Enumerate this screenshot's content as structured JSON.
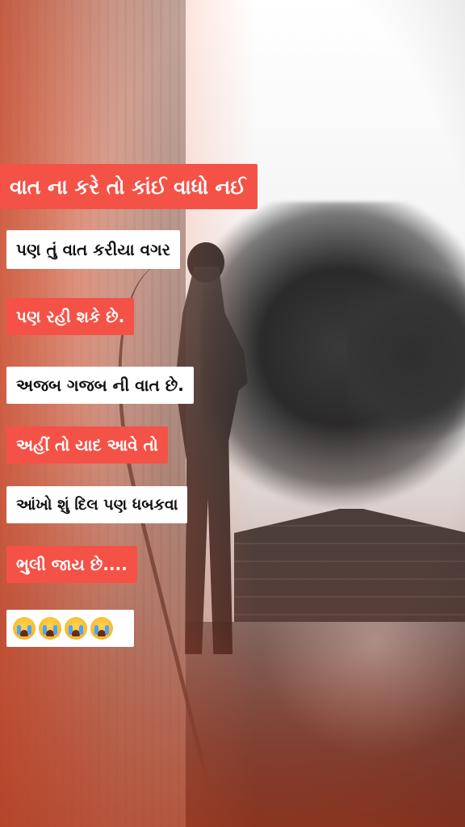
{
  "lines": [
    {
      "text": "વાત ના કરે તો કાંઈ વાધો નઈ",
      "style": "red"
    },
    {
      "text": "પણ તું વાત કરીયા વગર",
      "style": "white"
    },
    {
      "text": "પણ રહી શકે છે.",
      "style": "red"
    },
    {
      "text": "અજબ ગજબ ની વાત છે.",
      "style": "white"
    },
    {
      "text": "અહીં તો યાદ આવે તો",
      "style": "red"
    },
    {
      "text": "આંખો શું દિલ પણ ધબકવા",
      "style": "white"
    },
    {
      "text": "ભુલી જાય છે....",
      "style": "red"
    }
  ],
  "emoji_row": {
    "icon": "loudly-crying-face-icon",
    "count": 4
  },
  "colors": {
    "red_label": "#f45247",
    "white_label": "#ffffff"
  }
}
